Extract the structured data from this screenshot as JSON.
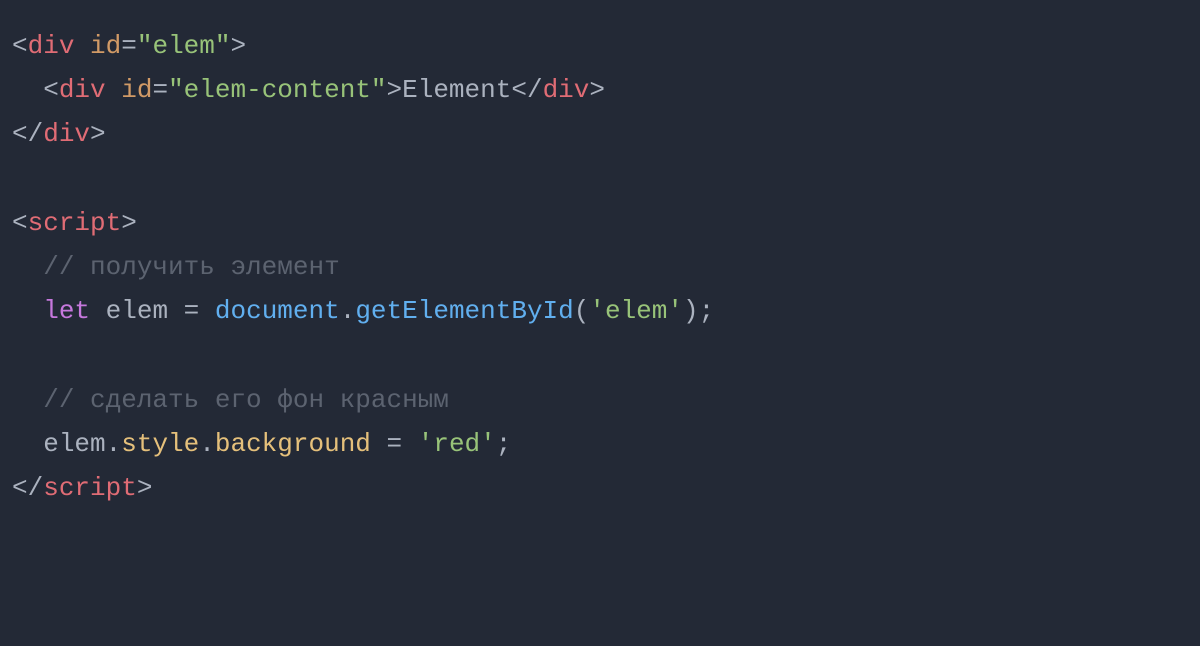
{
  "code": {
    "line1": {
      "open_bracket": "<",
      "tag": "div",
      "space": " ",
      "attr": "id",
      "eq": "=",
      "val": "\"elem\"",
      "close_bracket": ">"
    },
    "line2": {
      "indent": "  ",
      "open_bracket": "<",
      "tag": "div",
      "space": " ",
      "attr": "id",
      "eq": "=",
      "val": "\"elem-content\"",
      "close_bracket": ">",
      "text": "Element",
      "close_open": "</",
      "close_tag": "div",
      "close_close": ">"
    },
    "line3": {
      "close_open": "</",
      "tag": "div",
      "close_close": ">"
    },
    "line5": {
      "open_bracket": "<",
      "tag": "script",
      "close_bracket": ">"
    },
    "line6": {
      "indent": "  ",
      "comment": "// получить элемент"
    },
    "line7": {
      "indent": "  ",
      "keyword": "let",
      "space1": " ",
      "var": "elem",
      "space2": " ",
      "eq": "=",
      "space3": " ",
      "obj": "document",
      "dot": ".",
      "method": "getElementById",
      "paren_open": "(",
      "arg": "'elem'",
      "paren_close": ")",
      "semi": ";"
    },
    "line9": {
      "indent": "  ",
      "comment": "// сделать его фон красным"
    },
    "line10": {
      "indent": "  ",
      "var": "elem",
      "dot1": ".",
      "prop1": "style",
      "dot2": ".",
      "prop2": "background",
      "space1": " ",
      "eq": "=",
      "space2": " ",
      "val": "'red'",
      "semi": ";"
    },
    "line11": {
      "close_open": "</",
      "tag": "script",
      "close_close": ">"
    }
  }
}
